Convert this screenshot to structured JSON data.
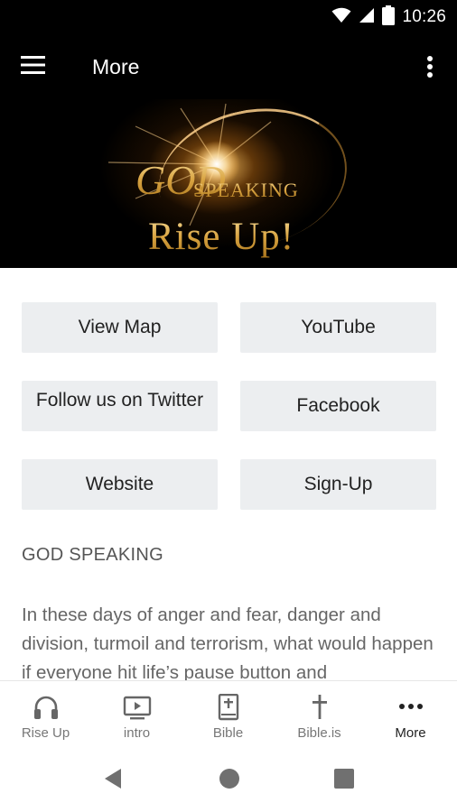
{
  "status_bar": {
    "time": "10:26",
    "icons": [
      "wifi-icon",
      "cell-signal-icon",
      "battery-icon"
    ]
  },
  "app_bar": {
    "title": "More",
    "menu_icon": "hamburger-menu-icon",
    "overflow_icon": "more-vert-icon"
  },
  "banner": {
    "logo_text_line1": "GOD",
    "logo_text_line2": "SPEAKING",
    "logo_text_line3": "Rise Up!"
  },
  "tiles": [
    {
      "label": "View Map"
    },
    {
      "label": "YouTube"
    },
    {
      "label": "Follow us on Twitter"
    },
    {
      "label": "Facebook"
    },
    {
      "label": "Website"
    },
    {
      "label": "Sign-Up"
    }
  ],
  "section": {
    "title": "GOD SPEAKING",
    "body": "In these days of anger and fear, danger and division, turmoil and terrorism, what would happen if everyone hit life’s pause button and"
  },
  "bottom_nav": {
    "items": [
      {
        "label": "Rise Up",
        "icon": "headphones-icon"
      },
      {
        "label": "intro",
        "icon": "tv-play-icon"
      },
      {
        "label": "Bible",
        "icon": "bible-book-icon"
      },
      {
        "label": "Bible.is",
        "icon": "cross-icon"
      },
      {
        "label": "More",
        "icon": "more-horiz-icon"
      }
    ],
    "active": "More"
  },
  "system_nav": [
    "back-icon",
    "home-icon",
    "recents-icon"
  ],
  "colors": {
    "header_bg": "#000000",
    "tile_bg": "#eceef0",
    "logo_gold": "#d9a441"
  }
}
